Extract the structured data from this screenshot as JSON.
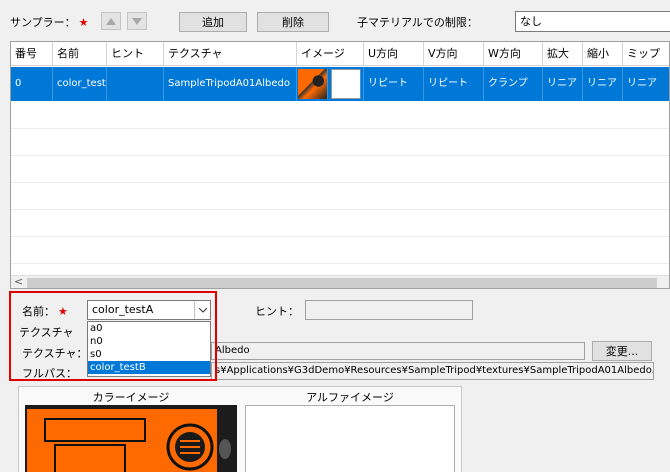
{
  "sampler": {
    "label": "サンプラー：",
    "required_mark": "★"
  },
  "toolbar": {
    "add_label": "追加",
    "delete_label": "削除"
  },
  "child_limit": {
    "label": "子マテリアルでの制限：",
    "value": "なし"
  },
  "table": {
    "columns": [
      "番号",
      "名前",
      "ヒント",
      "テクスチャ",
      "イメージ",
      "U方向",
      "V方向",
      "W方向",
      "拡大",
      "縮小",
      "ミップ"
    ],
    "rows": [
      {
        "index": "0",
        "name": "color_test",
        "hint": "",
        "texture": "SampleTripodA01Albedo",
        "u": "リピート",
        "v": "リピート",
        "w": "クランプ",
        "mag": "リニア",
        "min": "リニア",
        "mip": "リニア"
      }
    ],
    "scroll_left": "<"
  },
  "detail": {
    "name_label": "名前：",
    "required_mark": "★",
    "name_value": "color_testA",
    "hint_label": "ヒント：",
    "hint_value": "",
    "texture_section_label": "テクスチャ",
    "texture_label": "テクスチャ：",
    "texture_value": "Albedo",
    "change_button": "変更...",
    "fullpath_label": "フルパス：",
    "fullpath_value": "s¥Applications¥G3dDemo¥Resources¥SampleTripod¥textures¥SampleTripodA01Albedo.ftxb",
    "dropdown_options": [
      "a0",
      "n0",
      "s0",
      "color_testB"
    ],
    "dropdown_selected": "color_testB"
  },
  "preview": {
    "color_title": "カラーイメージ",
    "alpha_title": "アルファイメージ"
  },
  "colors": {
    "selection": "#0078d7",
    "required": "#e00000",
    "texture_orange": "#ff6a00"
  }
}
